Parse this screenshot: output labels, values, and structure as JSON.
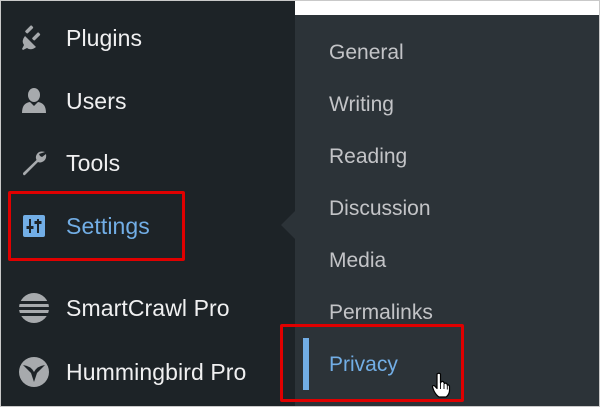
{
  "sidebar": {
    "items": [
      {
        "label": "Plugins",
        "icon": "plugin-icon"
      },
      {
        "label": "Users",
        "icon": "user-icon"
      },
      {
        "label": "Tools",
        "icon": "wrench-icon"
      },
      {
        "label": "Settings",
        "icon": "settings-sliders-icon",
        "active": true
      },
      {
        "label": "SmartCrawl Pro",
        "icon": "smartcrawl-icon"
      },
      {
        "label": "Hummingbird Pro",
        "icon": "hummingbird-icon"
      }
    ]
  },
  "submenu": {
    "items": [
      {
        "label": "General"
      },
      {
        "label": "Writing"
      },
      {
        "label": "Reading"
      },
      {
        "label": "Discussion"
      },
      {
        "label": "Media"
      },
      {
        "label": "Permalinks"
      },
      {
        "label": "Privacy",
        "current": true
      }
    ]
  },
  "colors": {
    "sidebar_bg": "#1d2327",
    "submenu_bg": "#2c3338",
    "active_text": "#72aee6",
    "menu_text": "#f0f0f1",
    "submenu_text": "#c3c4c7",
    "highlight_red": "#e00000"
  }
}
